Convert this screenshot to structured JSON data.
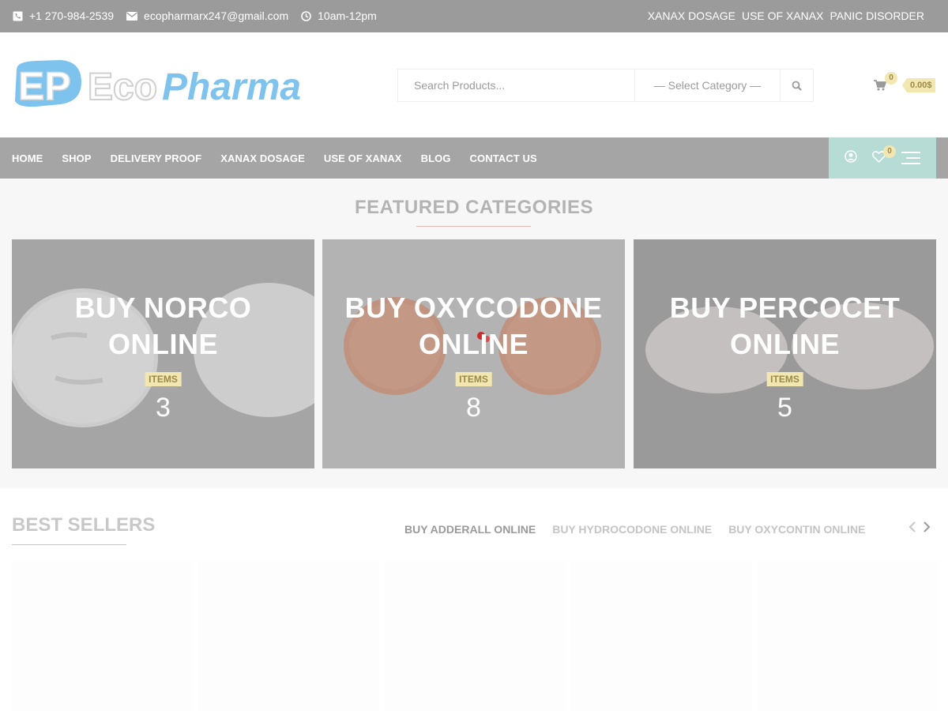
{
  "topbar": {
    "phone": "+1 270-984-2539",
    "email": "ecopharmarx247@gmail.com",
    "hours": "10am-12pm",
    "links": [
      "XANAX DOSAGE",
      "USE OF XANAX",
      "PANIC DISORDER"
    ]
  },
  "header": {
    "logo_letters": "EP",
    "logo_eco": "Eco",
    "logo_pharma": "Pharma",
    "search_placeholder": "Search Products...",
    "category_select": "— Select Category —",
    "cart_count": "0",
    "cart_amount": "0.00$"
  },
  "nav": {
    "items": [
      "HOME",
      "SHOP",
      "DELIVERY PROOF",
      "XANAX DOSAGE",
      "USE OF XANAX",
      "BLOG",
      "CONTACT US"
    ],
    "wishlist_count": "0"
  },
  "featured": {
    "title": "FEATURED CATEGORIES",
    "items_label": "ITEMS",
    "categories": [
      {
        "line1": "BUY NORCO",
        "line2": "ONLINE",
        "count": "3"
      },
      {
        "line1": "BUY OXYCODONE",
        "line2": "ONLINE",
        "count": "8"
      },
      {
        "line1": "BUY PERCOCET",
        "line2": "ONLINE",
        "count": "5"
      }
    ]
  },
  "best_sellers": {
    "title": "BEST SELLERS",
    "tabs": [
      "BUY ADDERALL ONLINE",
      "BUY HYDROCODONE ONLINE",
      "BUY OXYCONTIN ONLINE"
    ]
  },
  "colors": {
    "topbar_bg": "#9b9b9b",
    "nav_bg": "#a5a5a5",
    "nav_accent": "#b7dcd5",
    "badge_bg": "#f2e7b0",
    "logo_blue": "#7ec3ee"
  }
}
